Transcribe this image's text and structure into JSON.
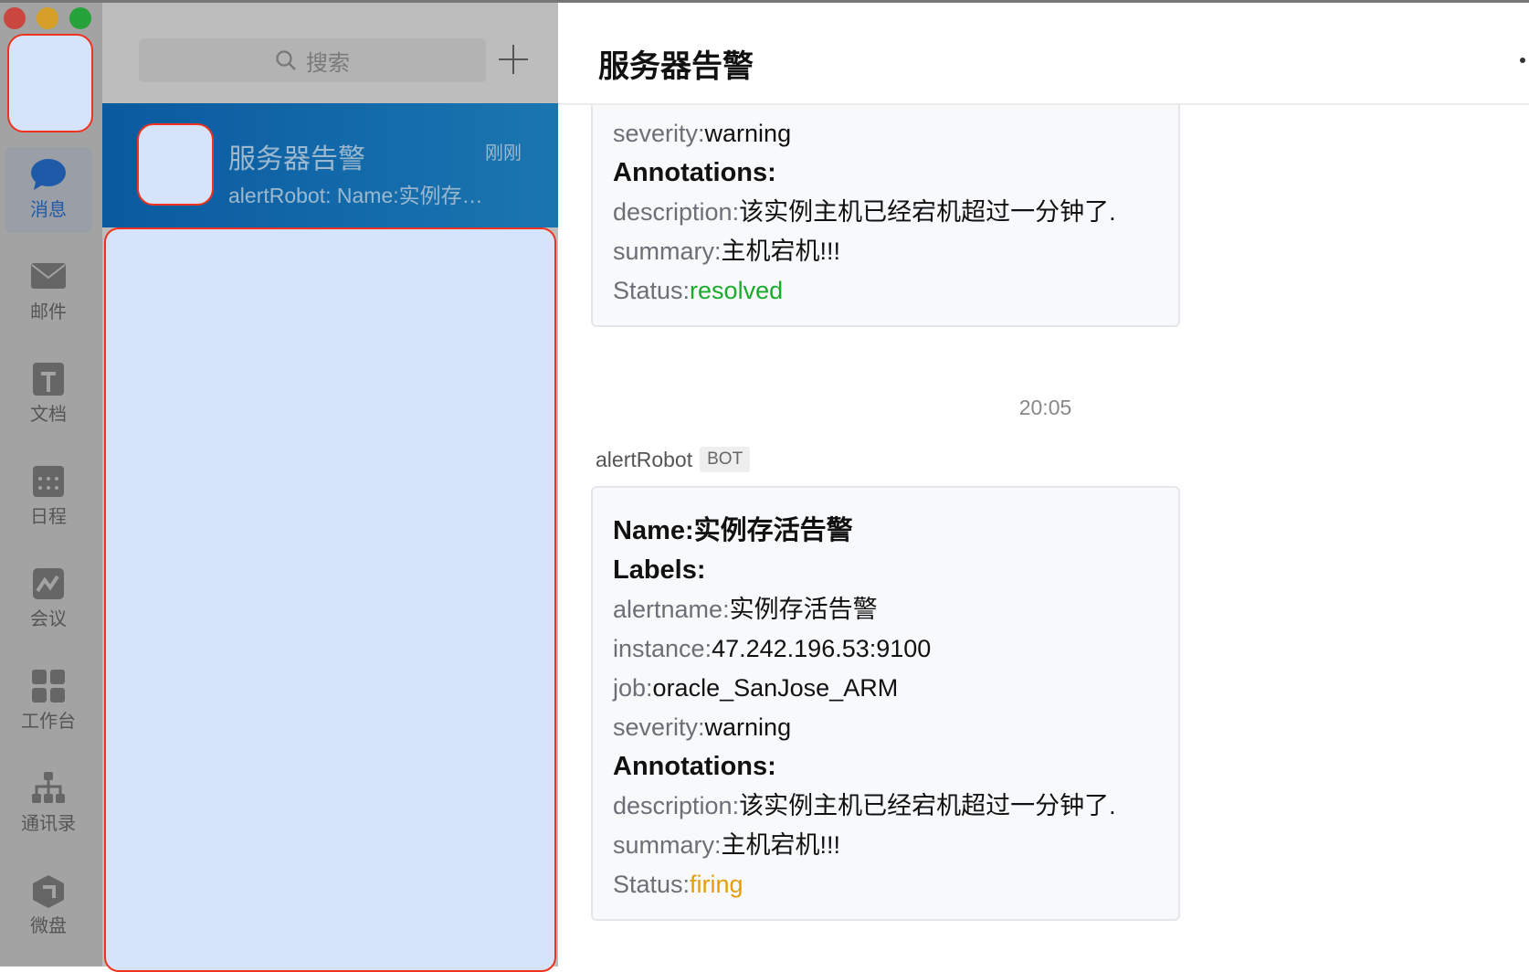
{
  "window": {
    "traffic_lights": [
      "#c9473f",
      "#d6a02a",
      "#26a23a"
    ]
  },
  "rail": {
    "items": [
      {
        "label": "消息",
        "icon": "chat-bubble-icon",
        "active": true
      },
      {
        "label": "邮件",
        "icon": "mail-icon"
      },
      {
        "label": "文档",
        "icon": "document-icon"
      },
      {
        "label": "日程",
        "icon": "calendar-icon"
      },
      {
        "label": "会议",
        "icon": "meeting-icon"
      },
      {
        "label": "工作台",
        "icon": "workbench-icon"
      },
      {
        "label": "通讯录",
        "icon": "contacts-icon"
      },
      {
        "label": "微盘",
        "icon": "drive-icon"
      }
    ]
  },
  "list": {
    "search_placeholder": "搜索",
    "conversation": {
      "name": "服务器告警",
      "time": "刚刚",
      "preview": "alertRobot: Name:实例存…"
    }
  },
  "chat": {
    "title": "服务器告警",
    "msg1": {
      "lines": [
        [
          "severity:",
          "warning"
        ],
        [
          "Annotations:"
        ],
        [
          "description:",
          "该实例主机已经宕机超过一分钟了."
        ],
        [
          "summary:",
          "主机宕机!!!"
        ],
        [
          "Status:",
          "resolved"
        ]
      ]
    },
    "time": "20:05",
    "sender": "alertRobot",
    "badge": "BOT",
    "msg2": {
      "lines": [
        [
          "Name:实例存活告警"
        ],
        [
          "Labels:"
        ],
        [
          "alertname:",
          "实例存活告警"
        ],
        [
          "instance:",
          "47.242.196.53:9100"
        ],
        [
          "job:",
          "oracle_SanJose_ARM"
        ],
        [
          "severity:",
          "warning"
        ],
        [
          "Annotations:"
        ],
        [
          "description:",
          "该实例主机已经宕机超过一分钟了."
        ],
        [
          "summary:",
          "主机宕机!!!"
        ],
        [
          "Status:",
          "firing"
        ]
      ]
    },
    "colors": {
      "resolved": "#1aab2c",
      "firing": "#e39d0e"
    }
  }
}
